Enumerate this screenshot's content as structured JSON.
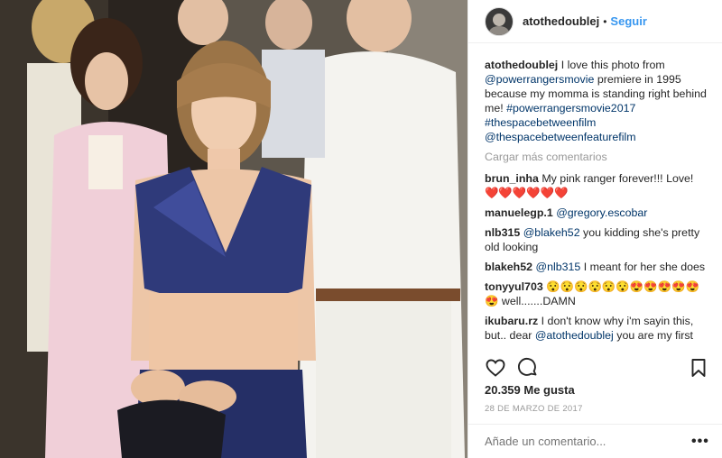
{
  "header": {
    "username": "atothedoublej",
    "separator": "•",
    "follow_label": "Seguir"
  },
  "caption": {
    "username": "atothedoublej",
    "text_1": "I love this photo from",
    "mention_1": "@powerrangersmovie",
    "text_2": "premiere in 1995 because my momma is standing right behind me!",
    "hashtag_1": "#powerrangersmovie2017",
    "hashtag_2": "#thespacebetweenfilm",
    "mention_2": "@thespacebetweenfeaturefilm"
  },
  "load_more": "Cargar más comentarios",
  "comments": [
    {
      "user": "brun_inha",
      "text": "My pink ranger forever!!! Love!",
      "extra": "❤️❤️❤️❤️❤️❤️"
    },
    {
      "user": "manuelegp.1",
      "mention": "@gregory.escobar",
      "text": ""
    },
    {
      "user": "nlb315",
      "mention": "@blakeh52",
      "text": "you kidding she's pretty old looking"
    },
    {
      "user": "blakeh52",
      "mention": "@nlb315",
      "text": "I meant for her she does"
    },
    {
      "user": "tonyyul703",
      "text": "😯😯😯😯😯😯😍😍😍😍😍😍 well.......DAMN"
    },
    {
      "user": "ikubaru.rz",
      "text": "I don't know why i'm sayin this, but.. dear",
      "mention": "@atothedoublej",
      "text_after": "you are my first"
    }
  ],
  "likes": "20.359 Me gusta",
  "date": "28 DE MARZO DE 2017",
  "add_comment_placeholder": "Añade un comentario...",
  "more_options": "•••",
  "icons": {
    "like": "heart-icon",
    "comment": "comment-icon",
    "save": "bookmark-icon",
    "avatar": "avatar"
  },
  "colors": {
    "link": "#003569",
    "follow": "#3897f0",
    "muted": "#999999",
    "text": "#262626"
  }
}
